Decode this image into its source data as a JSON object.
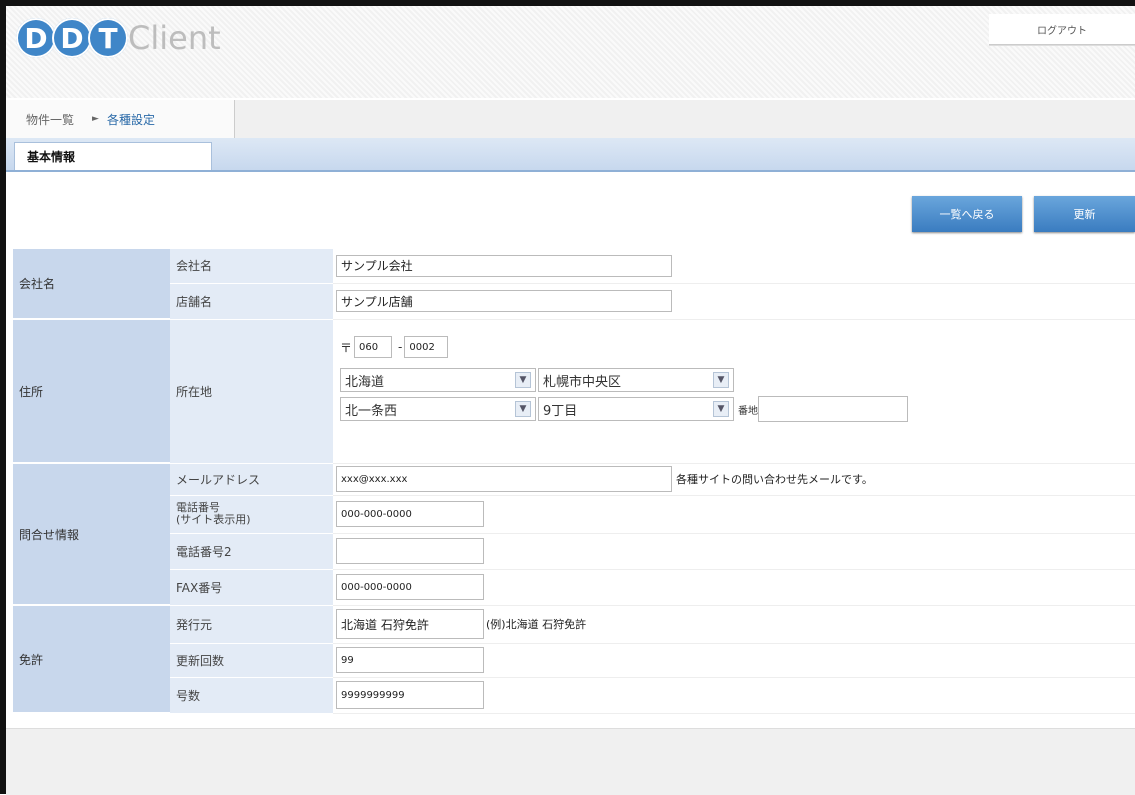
{
  "brand": {
    "letters": [
      "D",
      "D",
      "T"
    ],
    "name": "Client"
  },
  "header": {
    "logout_label": "ログアウト"
  },
  "breadcrumb": {
    "items": [
      "物件一覧",
      "各種設定"
    ],
    "arrow": "►"
  },
  "tabs": [
    {
      "label": "基本情報"
    }
  ],
  "actions": {
    "back_label": "一覧へ戻る",
    "update_label": "更新"
  },
  "sections": {
    "company": {
      "label": "会社名",
      "company_name": {
        "label": "会社名",
        "value": "サンプル会社"
      },
      "store_name": {
        "label": "店舗名",
        "value": "サンプル店舗"
      }
    },
    "address": {
      "label": "住所",
      "field_label": "所在地",
      "postal_mark": "〒",
      "postal1": "060",
      "postal_sep": "-",
      "postal2": "0002",
      "prefecture": "北海道",
      "city": "札幌市中央区",
      "town": "北一条西",
      "chome": "9丁目",
      "banchi_label": "番地",
      "banchi": ""
    },
    "contact": {
      "label": "問合せ情報",
      "email": {
        "label": "メールアドレス",
        "value": "xxx@xxx.xxx",
        "note": "各種サイトの問い合わせ先メールです。"
      },
      "phone_site": {
        "label_line1": "電話番号",
        "label_line2": "(サイト表示用)",
        "value": "000-000-0000"
      },
      "phone2": {
        "label": "電話番号2",
        "value": ""
      },
      "fax": {
        "label": "FAX番号",
        "value": "000-000-0000"
      }
    },
    "license": {
      "label": "免許",
      "issuer": {
        "label": "発行元",
        "value": "北海道 石狩免許",
        "note": "(例)北海道 石狩免許"
      },
      "renewal": {
        "label": "更新回数",
        "value": "99"
      },
      "number": {
        "label": "号数",
        "value": "9999999999"
      }
    }
  },
  "colors": {
    "accent": "#3f86c8",
    "section_bg": "#c8d7ec",
    "label_bg": "#e3ebf6"
  }
}
